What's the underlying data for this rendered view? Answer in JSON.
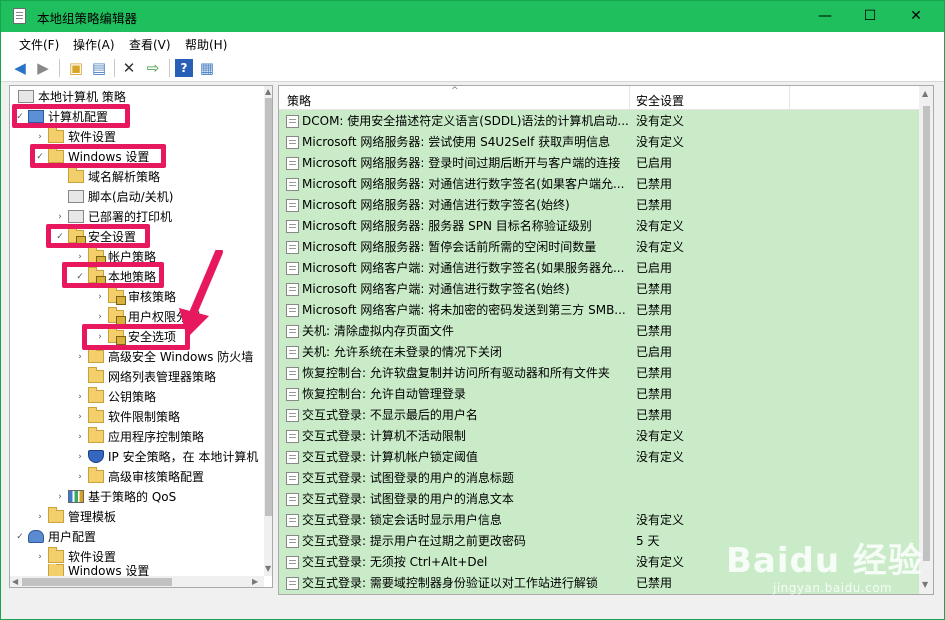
{
  "window": {
    "title": "本地组策略编辑器",
    "controls": [
      "—",
      "☐",
      "✕"
    ]
  },
  "menu": [
    "文件(F)",
    "操作(A)",
    "查看(V)",
    "帮助(H)"
  ],
  "toolbar_icons": [
    "back-arrow-icon",
    "forward-arrow-icon",
    "up-folder-icon",
    "show-hide-tree-icon",
    "delete-x-icon",
    "export-list-icon",
    "help-icon",
    "properties-icon"
  ],
  "tree": {
    "root": "本地计算机 策略",
    "computer_config": "计算机配置",
    "software_settings": "软件设置",
    "windows_settings": "Windows 设置",
    "name_resolution_policy": "域名解析策略",
    "scripts": "脚本(启动/关机)",
    "deployed_printers": "已部署的打印机",
    "security_settings": "安全设置",
    "account_policies": "帐户策略",
    "local_policies": "本地策略",
    "audit_policy": "审核策略",
    "user_rights": "用户权限分配",
    "security_options": "安全选项",
    "firewall": "高级安全 Windows 防火墙",
    "network_list": "网络列表管理器策略",
    "public_key": "公钥策略",
    "software_restriction": "软件限制策略",
    "app_control": "应用程序控制策略",
    "ipsec": "IP 安全策略，在 本地计算机",
    "advanced_audit": "高级审核策略配置",
    "qos": "基于策略的 QoS",
    "admin_templates": "管理模板",
    "user_config": "用户配置",
    "user_software_settings": "软件设置",
    "partial": "Windows 设置"
  },
  "list": {
    "col_policy": "策略",
    "col_setting": "安全设置",
    "rows": [
      {
        "policy": "DCOM: 使用安全描述符定义语言(SDDL)语法的计算机启动...",
        "setting": "没有定义"
      },
      {
        "policy": "Microsoft 网络服务器: 尝试使用 S4U2Self 获取声明信息",
        "setting": "没有定义"
      },
      {
        "policy": "Microsoft 网络服务器: 登录时间过期后断开与客户端的连接",
        "setting": "已启用"
      },
      {
        "policy": "Microsoft 网络服务器: 对通信进行数字签名(如果客户端允...",
        "setting": "已禁用"
      },
      {
        "policy": "Microsoft 网络服务器: 对通信进行数字签名(始终)",
        "setting": "已禁用"
      },
      {
        "policy": "Microsoft 网络服务器: 服务器 SPN 目标名称验证级别",
        "setting": "没有定义"
      },
      {
        "policy": "Microsoft 网络服务器: 暂停会话前所需的空闲时间数量",
        "setting": "没有定义"
      },
      {
        "policy": "Microsoft 网络客户端: 对通信进行数字签名(如果服务器允...",
        "setting": "已启用"
      },
      {
        "policy": "Microsoft 网络客户端: 对通信进行数字签名(始终)",
        "setting": "已禁用"
      },
      {
        "policy": "Microsoft 网络客户端: 将未加密的密码发送到第三方 SMB...",
        "setting": "已禁用"
      },
      {
        "policy": "关机: 清除虚拟内存页面文件",
        "setting": "已禁用"
      },
      {
        "policy": "关机: 允许系统在未登录的情况下关闭",
        "setting": "已启用"
      },
      {
        "policy": "恢复控制台: 允许软盘复制并访问所有驱动器和所有文件夹",
        "setting": "已禁用"
      },
      {
        "policy": "恢复控制台: 允许自动管理登录",
        "setting": "已禁用"
      },
      {
        "policy": "交互式登录: 不显示最后的用户名",
        "setting": "已禁用"
      },
      {
        "policy": "交互式登录: 计算机不活动限制",
        "setting": "没有定义"
      },
      {
        "policy": "交互式登录: 计算机帐户锁定阈值",
        "setting": "没有定义"
      },
      {
        "policy": "交互式登录: 试图登录的用户的消息标题",
        "setting": ""
      },
      {
        "policy": "交互式登录: 试图登录的用户的消息文本",
        "setting": ""
      },
      {
        "policy": "交互式登录: 锁定会话时显示用户信息",
        "setting": "没有定义"
      },
      {
        "policy": "交互式登录: 提示用户在过期之前更改密码",
        "setting": "5 天"
      },
      {
        "policy": "交互式登录: 无须按 Ctrl+Alt+Del",
        "setting": "没有定义"
      },
      {
        "policy": "交互式登录: 需要域控制器身份验证以对工作站进行解锁",
        "setting": "已禁用"
      }
    ]
  },
  "watermark": {
    "brand": "Baidu 经验",
    "url": "jingyan.baidu.com"
  },
  "colors": {
    "titlebar": "#1fbf5e",
    "list_bg": "#c9ebc8",
    "highlight": "#e8185f"
  }
}
